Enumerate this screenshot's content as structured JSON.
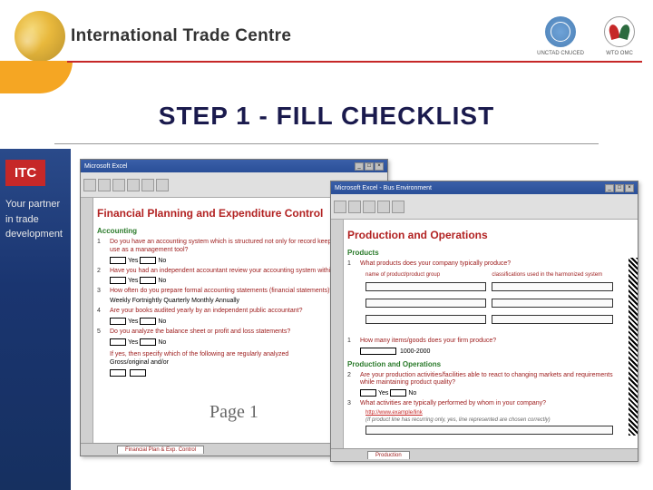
{
  "header": {
    "org_name": "International Trade Centre",
    "logo1_label": "UNCTAD CNUCED",
    "logo2_label": "WTO OMC"
  },
  "main_title": "STEP 1 - FILL CHECKLIST",
  "sidebar": {
    "itc": "ITC",
    "tagline1": "Your partner",
    "tagline2": "in trade",
    "tagline3": "development"
  },
  "win1": {
    "title": "Microsoft Excel",
    "section": "Financial Planning and Expenditure Control",
    "sub": "Accounting",
    "q1": "Do you have an accounting system which is structured not only for record keeping but also for use as a management tool?",
    "q2": "Have you had an independent accountant review your accounting system within the past year?",
    "q3": "How often do you prepare formal accounting statements (financial statements)?",
    "q3_opts": "Weekly  Fortnightly  Quarterly  Monthly  Annually",
    "q4": "Are your books audited yearly by an independent public accountant?",
    "q5": "Do you analyze the balance sheet or profit and loss statements?",
    "note": "If yes, then specify which of the following are regularly analyzed",
    "row_label": "Gross/original and/or",
    "yes": "Yes",
    "no": "No",
    "page": "Page 1",
    "tab": "Financial Plan & Exp. Control"
  },
  "win2": {
    "title": "Microsoft Excel - Bus Environment",
    "section": "Production and Operations",
    "sub1": "Products",
    "q1": "What products does your company typically produce?",
    "col1": "name of product/product group",
    "col2": "classifications used in the harmonized system",
    "q1b": "How many items/goods does your firm produce?",
    "q1b_box": "1000-2000",
    "sub2": "Production and Operations",
    "q2": "Are your production activities/facilities able to react to changing markets and requirements while maintaining product quality?",
    "q3": "What activities are typically performed by whom in your company?",
    "red1": "http://www.example/link",
    "grey": "(If product line has recurring only, yes, line represented are chosen correctly)",
    "yes": "Yes",
    "no": "No",
    "tab": "Production"
  }
}
